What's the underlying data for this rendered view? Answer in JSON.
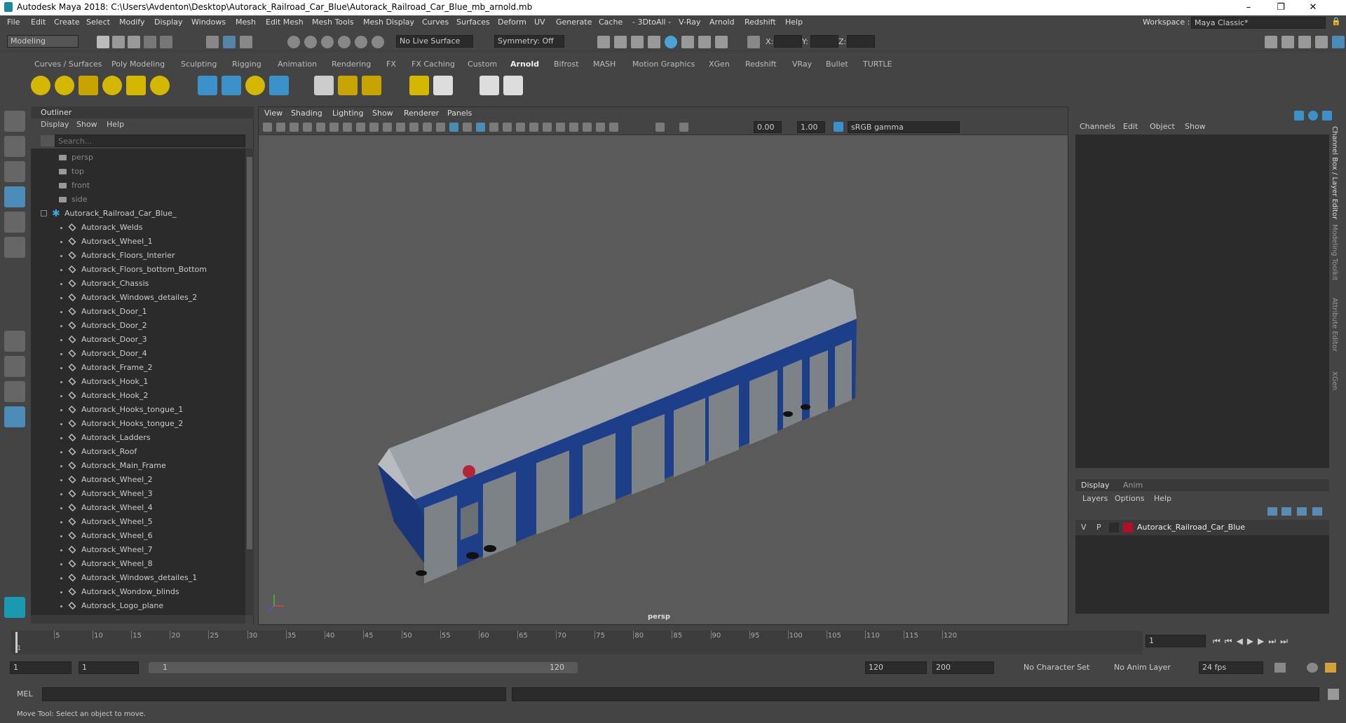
{
  "title": "Autodesk Maya 2018: C:\\Users\\Avdenton\\Desktop\\Autorack_Railroad_Car_Blue\\Autorack_Railroad_Car_Blue_mb_arnold.mb",
  "window_controls": [
    "–",
    "❐",
    "✕"
  ],
  "menu": [
    "File",
    "Edit",
    "Create",
    "Select",
    "Modify",
    "Display",
    "Windows",
    "Mesh",
    "Edit Mesh",
    "Mesh Tools",
    "Mesh Display",
    "Curves",
    "Surfaces",
    "Deform",
    "UV",
    "Generate",
    "Cache",
    "- 3DtoAll -",
    "V-Ray",
    "Arnold",
    "Redshift",
    "Help"
  ],
  "workspace": {
    "label": "Workspace :",
    "value": "Maya Classic*"
  },
  "status": {
    "mode": "Modeling",
    "live_surface": "No Live Surface",
    "symmetry": "Symmetry: Off",
    "x": "X:",
    "y": "Y:",
    "z": "Z:"
  },
  "shelf_tabs": [
    "Curves / Surfaces",
    "Poly Modeling",
    "Sculpting",
    "Rigging",
    "Animation",
    "Rendering",
    "FX",
    "FX Caching",
    "Custom",
    "Arnold",
    "Bifrost",
    "MASH",
    "Motion Graphics",
    "XGen",
    "Redshift",
    "VRay",
    "Bullet",
    "TURTLE"
  ],
  "active_shelf": "Arnold",
  "outliner": {
    "title": "Outliner",
    "menu": [
      "Display",
      "Show",
      "Help"
    ],
    "search_placeholder": "Search...",
    "cameras": [
      "persp",
      "top",
      "front",
      "side"
    ],
    "group": "Autorack_Railroad_Car_Blue_",
    "items": [
      "Autorack_Welds",
      "Autorack_Wheel_1",
      "Autorack_Floors_Interier",
      "Autorack_Floors_bottom_Bottom",
      "Autorack_Chassis",
      "Autorack_Windows_detailes_2",
      "Autorack_Door_1",
      "Autorack_Door_2",
      "Autorack_Door_3",
      "Autorack_Door_4",
      "Autorack_Frame_2",
      "Autorack_Hook_1",
      "Autorack_Hook_2",
      "Autorack_Hooks_tongue_1",
      "Autorack_Hooks_tongue_2",
      "Autorack_Ladders",
      "Autorack_Roof",
      "Autorack_Main_Frame",
      "Autorack_Wheel_2",
      "Autorack_Wheel_3",
      "Autorack_Wheel_4",
      "Autorack_Wheel_5",
      "Autorack_Wheel_6",
      "Autorack_Wheel_7",
      "Autorack_Wheel_8",
      "Autorack_Windows_detailes_1",
      "Autorack_Wondow_blinds",
      "Autorack_Logo_plane"
    ]
  },
  "viewport": {
    "menu": [
      "View",
      "Shading",
      "Lighting",
      "Show",
      "Renderer",
      "Panels"
    ],
    "exposure": "0.00",
    "gamma": "1.00",
    "colorspace": "sRGB gamma",
    "camera_label": "persp"
  },
  "channel_box": {
    "menu": [
      "Channels",
      "Edit",
      "Object",
      "Show"
    ],
    "side_tabs": [
      "Channel Box / Layer Editor",
      "Modeling Toolkit",
      "Attribute Editor",
      "XGen"
    ],
    "layer_tabs": [
      "Display",
      "Anim"
    ],
    "layer_menu": [
      "Layers",
      "Options",
      "Help"
    ],
    "layer": {
      "v": "V",
      "p": "P",
      "name": "Autorack_Railroad_Car_Blue",
      "color": "#b0102a"
    }
  },
  "timeline": {
    "ticks": [
      "5",
      "10",
      "15",
      "20",
      "25",
      "30",
      "35",
      "40",
      "45",
      "50",
      "55",
      "60",
      "65",
      "70",
      "75",
      "80",
      "85",
      "90",
      "95",
      "100",
      "105",
      "110",
      "115",
      "120"
    ],
    "first": "1",
    "current": "1"
  },
  "range": {
    "start": "1",
    "inner_start": "1",
    "slider_start": "1",
    "slider_end": "120",
    "end": "120",
    "max": "200",
    "character_set": "No Character Set",
    "anim_layer": "No Anim Layer",
    "fps": "24 fps"
  },
  "cmd": {
    "label": "MEL"
  },
  "help_line": "Move Tool: Select an object to move."
}
